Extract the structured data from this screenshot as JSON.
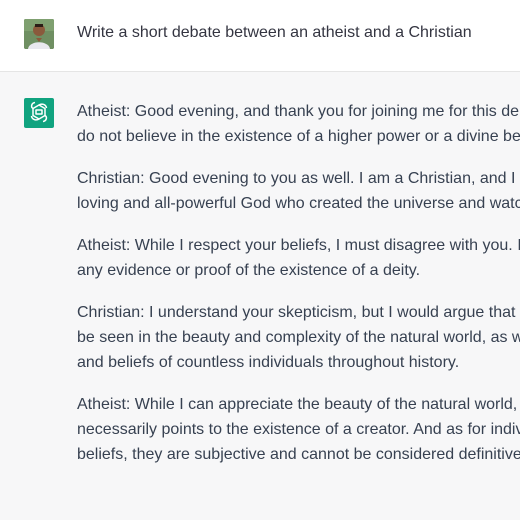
{
  "conversation": {
    "user_prompt": "Write a short debate between an atheist and a Christian",
    "assistant_paragraphs": [
      {
        "lines": [
          "Atheist: Good evening, and thank you for joining me for this deb",
          "do not believe in the existence of a higher power or a divine bei"
        ]
      },
      {
        "lines": [
          "Christian: Good evening to you as well. I am a Christian, and I be",
          "loving and all-powerful God who created the universe and watc"
        ]
      },
      {
        "lines": [
          "Atheist: While I respect your beliefs, I must disagree with you. I",
          "any evidence or proof of the existence of a deity."
        ]
      },
      {
        "lines": [
          "Christian: I understand your skepticism, but I would argue that t",
          "be seen in the beauty and complexity of the natural world, as w",
          "and beliefs of countless individuals throughout history."
        ]
      },
      {
        "lines": [
          "Atheist: While I can appreciate the beauty of the natural world,",
          "necessarily points to the existence of a creator. And as for indiv",
          "beliefs, they are subjective and cannot be considered definitive"
        ]
      }
    ]
  },
  "colors": {
    "user_row_bg": "#ffffff",
    "assistant_row_bg": "#f7f7f8",
    "assistant_avatar": "#10a37f",
    "text": "#374151"
  },
  "icons": {
    "user_avatar": "user-avatar-photo",
    "assistant_avatar": "openai-logo-icon"
  }
}
